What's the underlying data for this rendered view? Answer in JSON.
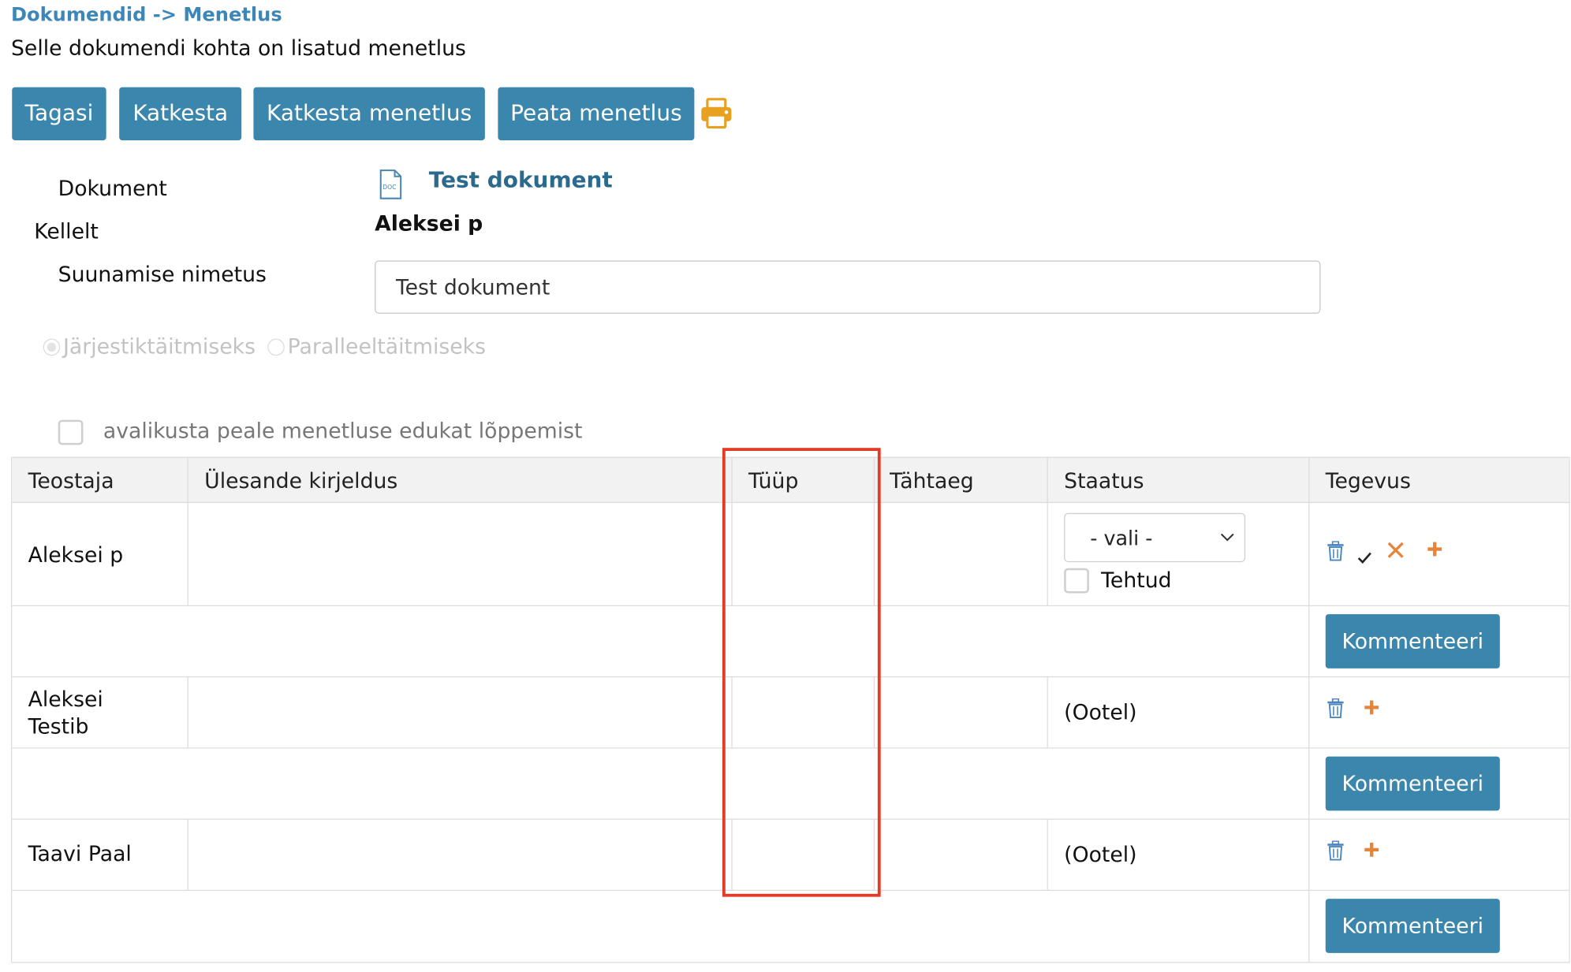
{
  "breadcrumb": "Dokumendid -> Menetlus",
  "subtitle": "Selle dokumendi kohta on lisatud menetlus",
  "toolbar": {
    "back_label": "Tagasi",
    "cancel_label": "Katkesta",
    "cancel_proc_label": "Katkesta menetlus",
    "stop_proc_label": "Peata menetlus",
    "print_icon": "printer-icon"
  },
  "form": {
    "document_label": "Dokument",
    "document_value": "Test dokument",
    "document_icon": "doc-file-icon",
    "from_label": "Kellelt",
    "from_value": "Aleksei p",
    "routing_label": "Suunamise nimetus",
    "routing_value": "Test dokument",
    "radio_sequential": "Järjestiktäitmiseks",
    "radio_parallel": "Paralleeltäitmiseks",
    "publish_label": "avalikusta peale menetluse edukat lõppemist"
  },
  "table": {
    "headers": [
      "Teostaja",
      "Ülesande kirjeldus",
      "Tüüp",
      "Tähtaeg",
      "Staatus",
      "Tegevus"
    ],
    "rows": [
      {
        "executor": "Aleksei p",
        "description": "",
        "type": "",
        "deadline": "",
        "status_select": "- vali -",
        "done_label": "Tehtud",
        "comment_label": "Kommenteeri"
      },
      {
        "executor": "Aleksei Testib",
        "description": "",
        "type": "",
        "deadline": "",
        "status": "(Ootel)",
        "comment_label": "Kommenteeri"
      },
      {
        "executor": "Taavi Paal",
        "description": "",
        "type": "",
        "deadline": "",
        "status": "(Ootel)",
        "comment_label": "Kommenteeri"
      }
    ]
  },
  "colors": {
    "button_bg": "#3b86ac",
    "link": "#2b6a8d",
    "breadcrumb": "#3d87b8",
    "highlight": "#e33b25",
    "accent_orange": "#e8843a"
  }
}
